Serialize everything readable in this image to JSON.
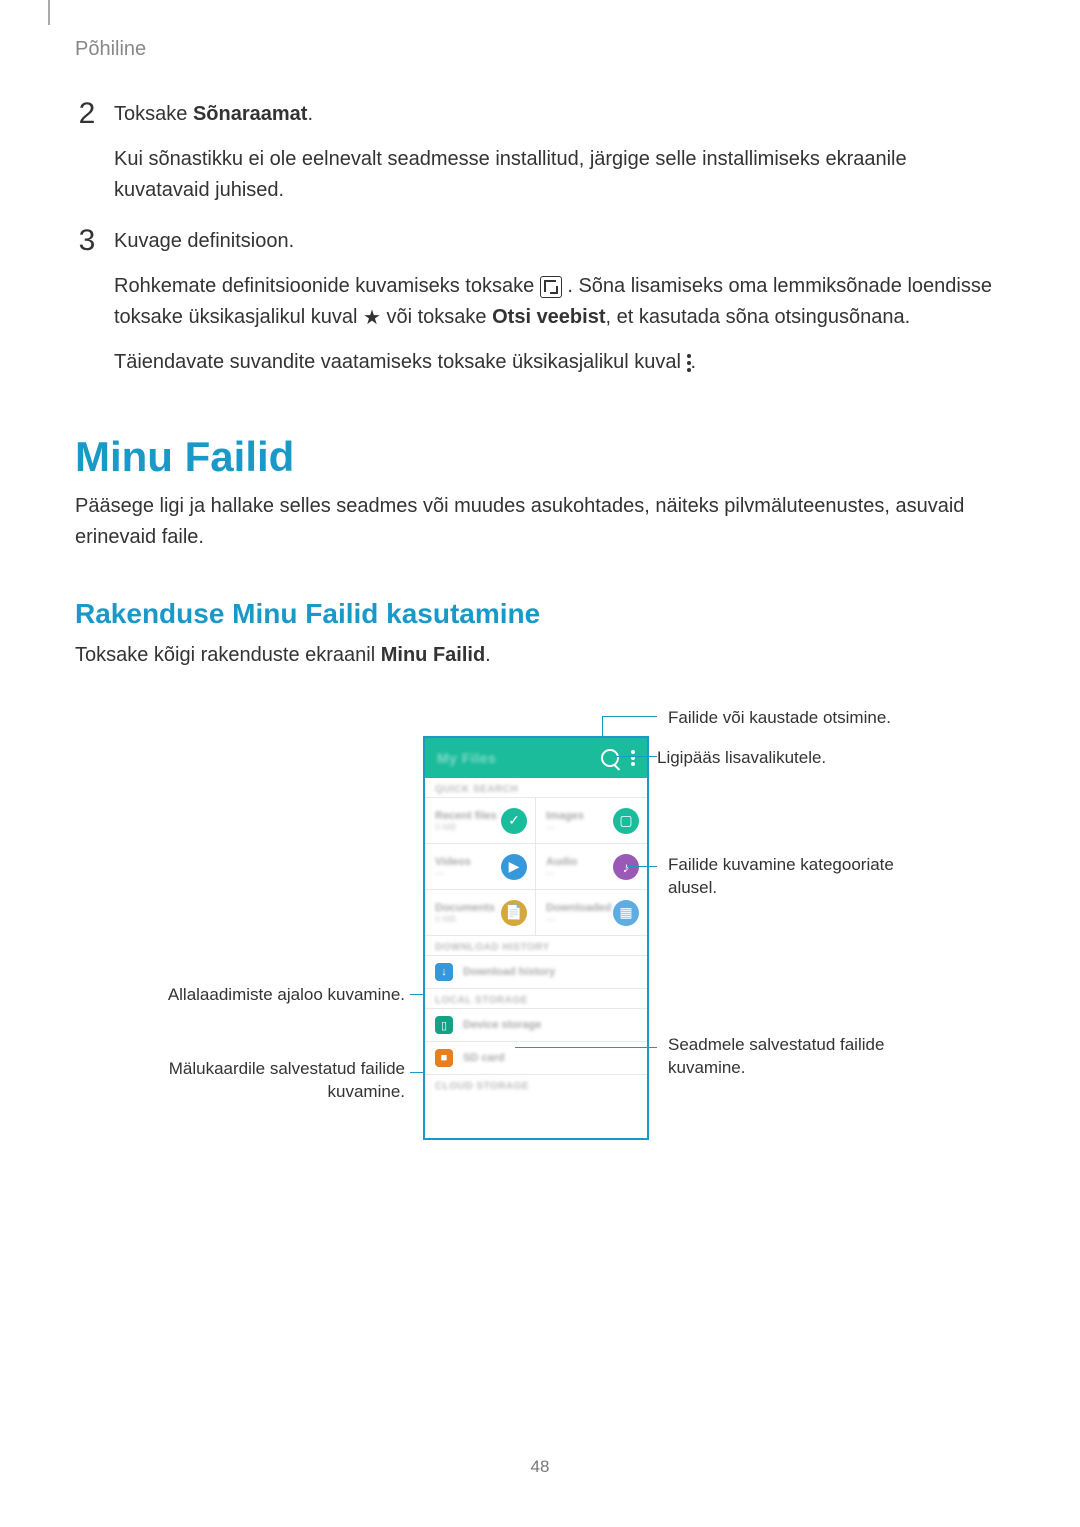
{
  "page": {
    "header": "Põhiline",
    "pageNumber": "48"
  },
  "step2": {
    "line1_a": "Toksake ",
    "line1_b": "Sõnaraamat",
    "line1_c": ".",
    "line2": "Kui sõnastikku ei ole eelnevalt seadmesse installitud, järgige selle installimiseks ekraanile kuvatavaid juhised."
  },
  "step3": {
    "line1": "Kuvage definitsioon.",
    "line2_a": "Rohkemate definitsioonide kuvamiseks toksake ",
    "line2_b": ". Sõna lisamiseks oma lemmiksõnade loendisse toksake üksikasjalikul kuval ",
    "line2_c": " või toksake ",
    "line2_d": "Otsi veebist",
    "line2_e": ", et kasutada sõna otsingusõnana.",
    "line3": "Täiendavate suvandite vaatamiseks toksake üksikasjalikul kuval "
  },
  "section": {
    "title": "Minu Failid",
    "intro": "Pääsege ligi ja hallake selles seadmes või muudes asukohtades, näiteks pilvmäluteenustes, asuvaid erinevaid faile.",
    "usageTitle": "Rakenduse Minu Failid kasutamine",
    "usageText_a": "Toksake kõigi rakenduste ekraanil ",
    "usageText_b": "Minu Failid",
    "usageText_c": "."
  },
  "callouts": {
    "search": "Failide või kaustade otsimine.",
    "options": "Ligipääs lisavalikutele.",
    "categories": "Failide kuvamine kategooriate alusel.",
    "downloads": "Allalaadimiste ajaloo kuvamine.",
    "device": "Seadmele salvestatud failide kuvamine.",
    "sdcard": "Mälukaardile salvestatud failide kuvamine."
  }
}
